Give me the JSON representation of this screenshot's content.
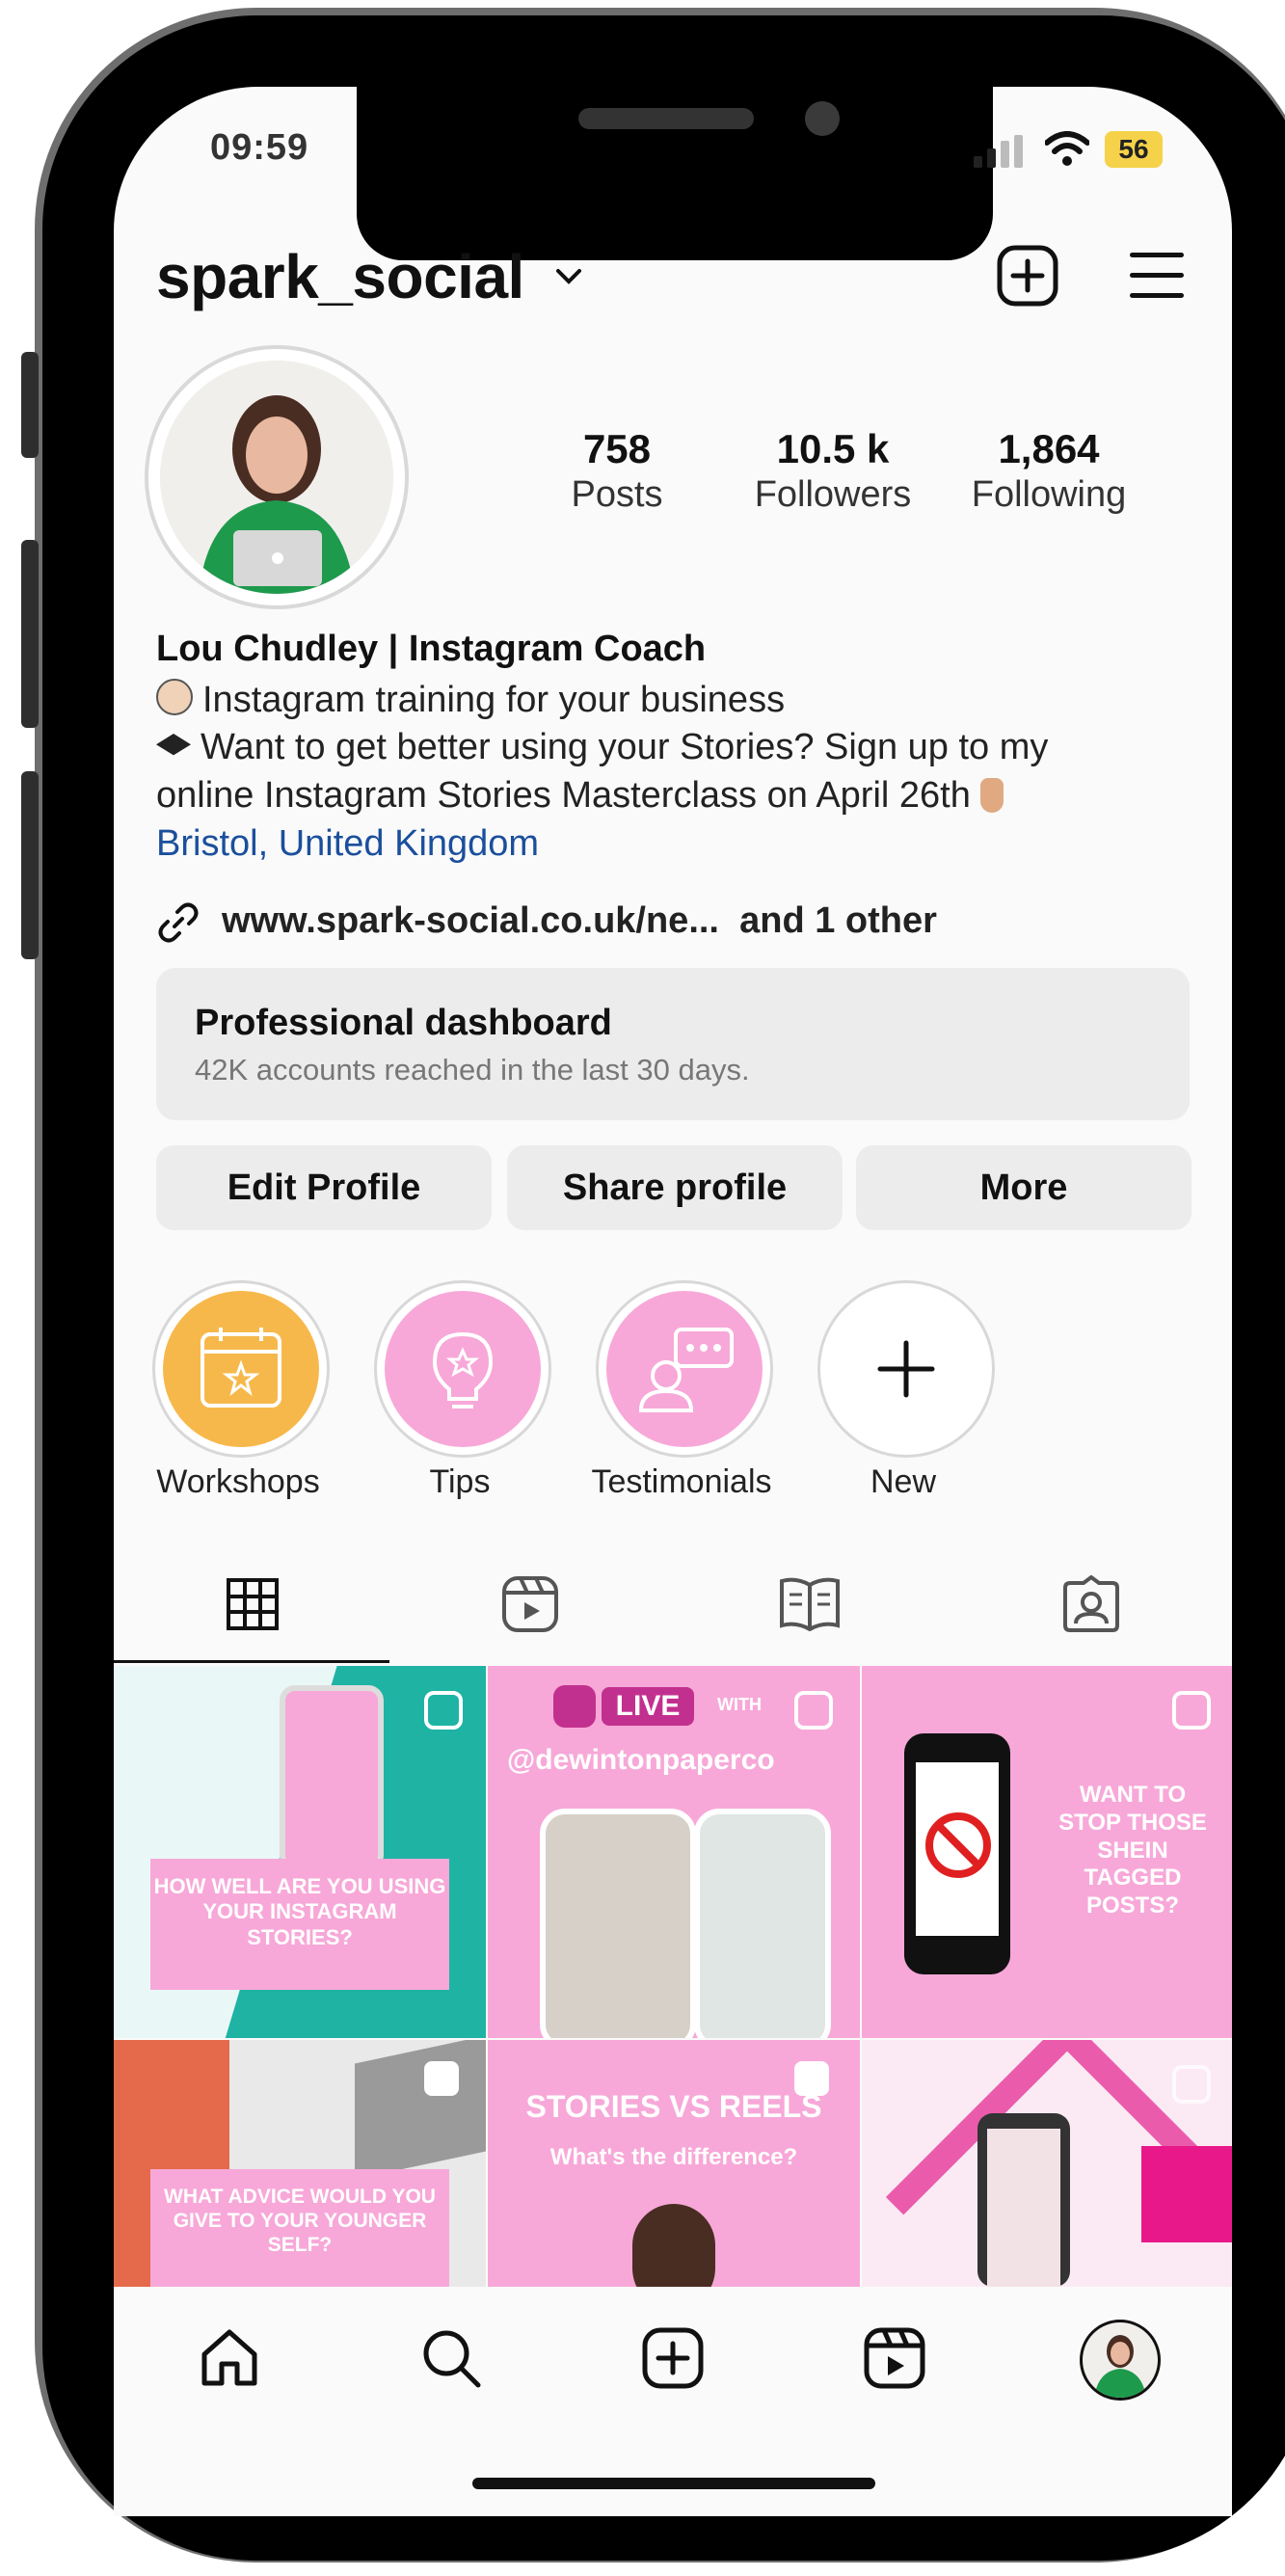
{
  "status_bar": {
    "time": "09:59",
    "battery": "56"
  },
  "header": {
    "username": "spark_social"
  },
  "stats": [
    {
      "value": "758",
      "label": "Posts"
    },
    {
      "value": "10.5 k",
      "label": "Followers"
    },
    {
      "value": "1,864",
      "label": "Following"
    }
  ],
  "bio": {
    "name": "Lou Chudley | Instagram Coach",
    "line1": "Instagram training for your business",
    "line2": "Want to get better using your Stories? Sign up to my",
    "line3": "online Instagram Stories Masterclass on April 26th",
    "location": "Bristol, United Kingdom",
    "link": "www.spark-social.co.uk/ne...",
    "link_more": "and 1 other"
  },
  "dashboard": {
    "title": "Professional dashboard",
    "subtitle": "42K accounts reached in the last 30 days."
  },
  "buttons": {
    "edit": "Edit Profile",
    "share": "Share profile",
    "more": "More"
  },
  "highlights": [
    {
      "label": "Workshops",
      "color": "#f7b84b"
    },
    {
      "label": "Tips",
      "color": "#f7a8d8"
    },
    {
      "label": "Testimonials",
      "color": "#f7a8d8"
    },
    {
      "label": "New",
      "color": "#ffffff"
    }
  ],
  "posts": {
    "p1": "HOW WELL ARE YOU USING YOUR INSTAGRAM STORIES?",
    "p2_live": "LIVE",
    "p2_with": "WITH",
    "p2_handle": "@dewintonpaperco",
    "p3": "WANT TO STOP THOSE SHEIN TAGGED POSTS?",
    "p4": "WHAT ADVICE WOULD YOU GIVE TO YOUR YOUNGER SELF?",
    "p5_title": "STORIES VS REELS",
    "p5_sub": "What's the difference?"
  },
  "colors": {
    "pink": "#f7a8d8",
    "link_blue": "#1b4f9c",
    "teal": "#1fb3a4"
  }
}
